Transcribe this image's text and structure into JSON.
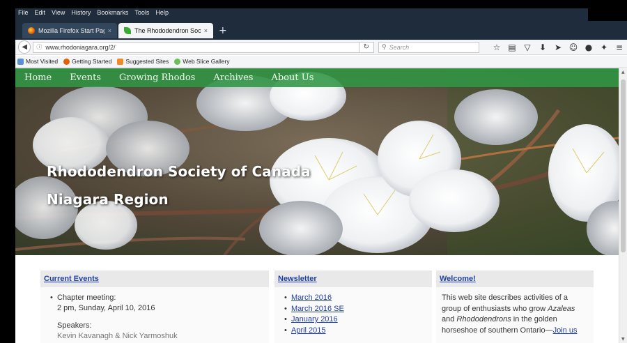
{
  "browser": {
    "menu": [
      "File",
      "Edit",
      "View",
      "History",
      "Bookmarks",
      "Tools",
      "Help"
    ],
    "tabs": [
      {
        "label": "Mozilla Firefox Start Page",
        "active": false
      },
      {
        "label": "The Rhododendron Societ...",
        "active": true
      }
    ],
    "new_tab": "+",
    "close": "×",
    "url": "www.rhodoniagara.org/2/",
    "search_placeholder": "Search",
    "bookmarks": [
      "Most Visited",
      "Getting Started",
      "Suggested Sites",
      "Web Slice Gallery"
    ],
    "colors": {
      "tabbar": "#1e2c3c",
      "active_tab": "#f4f5f7",
      "firefox_fav": "#e66000",
      "site_fav": "#3aaa35"
    }
  },
  "site": {
    "nav": [
      "Home",
      "Events",
      "Growing Rhodos",
      "Archives",
      "About Us"
    ],
    "title_line1": "Rhododendron Society of Canada",
    "title_line2": "Niagara Region",
    "colors": {
      "nav_bg": "#309644",
      "link": "#1f3fa8"
    }
  },
  "current_events": {
    "heading": "Current Events",
    "item": "Chapter meeting:",
    "when": "2 pm, Sunday, April 10, 2016",
    "speakers_label": "Speakers:",
    "speakers_cut": "Kevin Kavanagh & Nick Yarmoshuk"
  },
  "newsletter": {
    "heading": "Newsletter",
    "items": [
      "March 2016",
      "March 2016 SE",
      "January 2016",
      "April 2015"
    ]
  },
  "welcome": {
    "heading": "Welcome!",
    "line1": "This web site describes activities of a",
    "line2_a": "group of enthusiasts who grow ",
    "line2_b": "Azaleas",
    "line3_a": "and ",
    "line3_b": "Rhododendrons",
    "line3_c": " in the golden",
    "line4_a": "horseshoe of southern Ontario—",
    "line4_link": "Join us"
  }
}
